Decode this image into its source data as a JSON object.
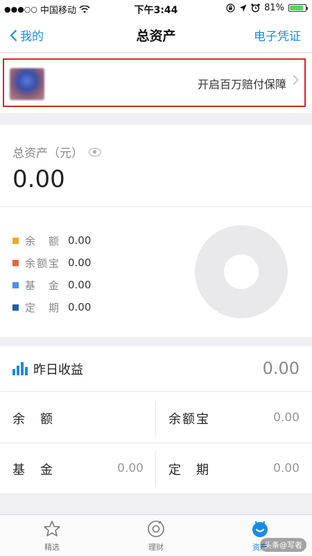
{
  "status_bar": {
    "signal_dots": "●●●○○",
    "carrier": "中国移动",
    "time": "下午3:44",
    "battery_percent": "81%",
    "battery_level": 0.81,
    "icons": [
      "wifi-icon",
      "lock-rotation-icon",
      "location-icon",
      "alarm-icon",
      "battery-icon"
    ]
  },
  "nav": {
    "back_label": "我的",
    "title": "总资产",
    "right_label": "电子凭证"
  },
  "banner": {
    "text": "开启百万赔付保障"
  },
  "total": {
    "label": "总资产（元）",
    "value": "0.00"
  },
  "legend": [
    {
      "label": "余　额",
      "value": "0.00",
      "color": "#f5a623"
    },
    {
      "label": "余额宝",
      "value": "0.00",
      "color": "#e8643c"
    },
    {
      "label": "基　金",
      "value": "0.00",
      "color": "#4a90e2"
    },
    {
      "label": "定　期",
      "value": "0.00",
      "color": "#1f5fa8"
    }
  ],
  "income": {
    "title": "昨日收益",
    "total": "0.00",
    "items": [
      {
        "label": "余　额",
        "value": ""
      },
      {
        "label": "余额宝",
        "value": "0.00"
      },
      {
        "label": "基　金",
        "value": "0.00"
      },
      {
        "label": "定　期",
        "value": "0.00"
      }
    ]
  },
  "tabs": [
    {
      "label": "精选",
      "icon": "star-icon",
      "active": false
    },
    {
      "label": "理财",
      "icon": "finance-icon",
      "active": false
    },
    {
      "label": "资产",
      "icon": "assets-icon",
      "active": true
    }
  ],
  "colors": {
    "accent": "#1a8ce0",
    "banner_border": "#d6242b",
    "donut": "#e9e9ec"
  },
  "watermark": "头条@写者"
}
